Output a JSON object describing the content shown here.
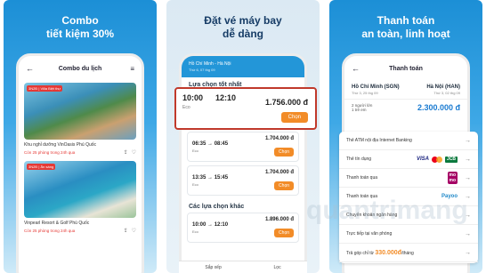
{
  "panels": {
    "p1": {
      "headline": [
        "Combo",
        "tiết kiệm 30%"
      ],
      "screen_title": "Combo du lịch",
      "tours": [
        {
          "tag": "3N2Đ | Villa Biệt thự",
          "name": "Khu nghỉ dưỡng VinOasis Phú Quốc",
          "left": "Còn 25 phòng trong 24h qua"
        },
        {
          "tag": "3N2Đ | Ăn sáng",
          "name": "Vinpearl Resort & Golf Phú Quốc",
          "left": "Còn 25 phòng trong 24h qua"
        }
      ]
    },
    "p2": {
      "headline": [
        "Đặt vé máy bay",
        "dễ dàng"
      ],
      "route": "Hồ Chí Minh - Hà Nội",
      "route_sub": "Thứ 6, 07 thg 09",
      "section_best": "Lựa chọn tốt nhất",
      "highlight": {
        "dep": "10:00",
        "arr": "12:10",
        "price": "1.756.000 đ",
        "meta": "Eco",
        "choose": "Chọn"
      },
      "flights": [
        {
          "dep": "06:35",
          "arr": "08:45",
          "price": "1.704.000 đ",
          "meta": "Eco",
          "choose": "Chọn"
        },
        {
          "dep": "13:35",
          "arr": "15:45",
          "price": "1.704.000 đ",
          "meta": "Eco",
          "choose": "Chọn"
        }
      ],
      "section_other": "Các lựa chọn khác",
      "other": {
        "dep": "10:00",
        "arr": "12:10",
        "price": "1.896.000 đ",
        "meta": "Eco",
        "choose": "Chọn"
      },
      "bottom": [
        "Sắp xếp",
        "Lọc"
      ]
    },
    "p3": {
      "headline": [
        "Thanh toán",
        "an toàn, linh hoạt"
      ],
      "screen_title": "Thanh toán",
      "from": "Hồ Chí Minh (SGN)",
      "to": "Hà Nội (HAN)",
      "date_from": "Thứ 3, 25 thg 09",
      "date_to": "Thứ 3, 02 thg 09",
      "pax": "2 người lớn",
      "pax_sub": "1 trẻ em",
      "total": "2.300.000 đ",
      "methods": [
        "Thẻ ATM nội địa Internet Banking",
        "Thẻ tín dụng",
        "Thanh toán qua",
        "Thanh toán qua",
        "Chuyển khoản ngân hàng",
        "Trực tiếp tại văn phòng"
      ],
      "pay_later_prefix": "Trả góp chỉ từ",
      "pay_later_amount": "330.000đ",
      "pay_later_suffix": "/tháng"
    }
  },
  "watermark": "quantrimang"
}
